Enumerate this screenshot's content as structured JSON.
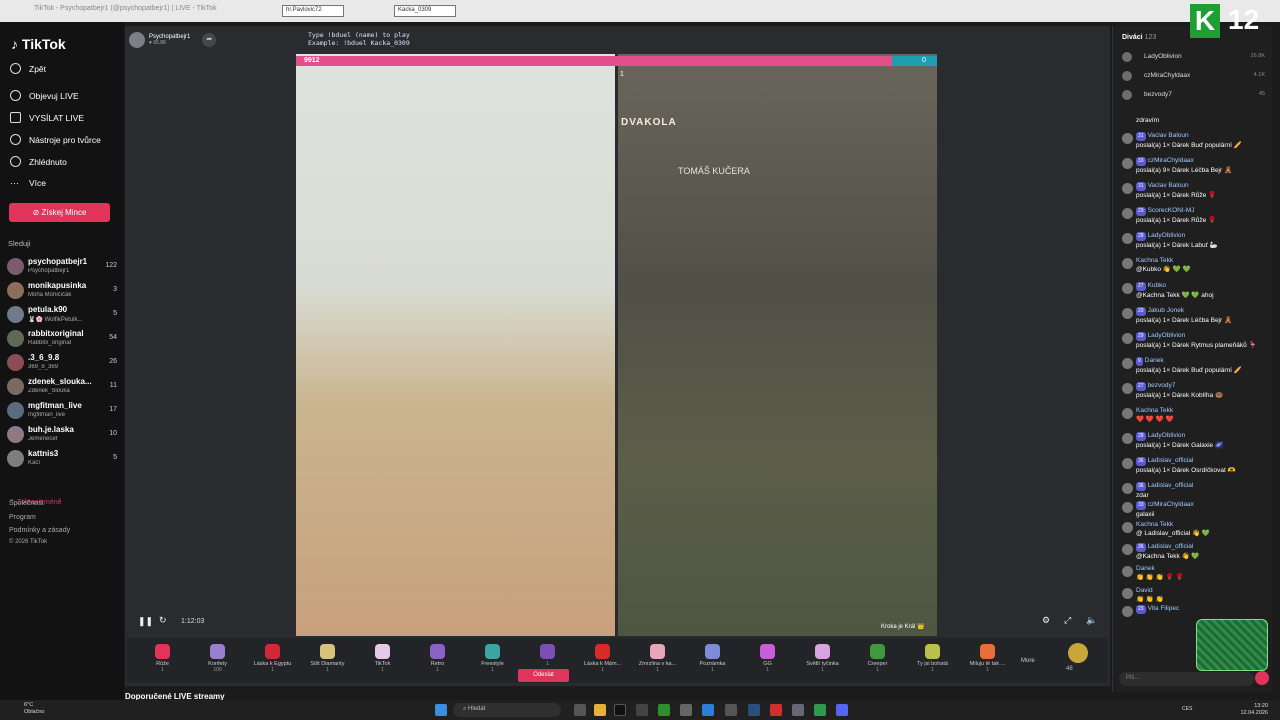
{
  "browser": {
    "url": "TikTok - Psychopatbejr1 (@psychopatbejr1) | LIVE - TikTok",
    "tabs": [
      "hr.Pavlovic72",
      "Kacka_0309"
    ]
  },
  "sidebar": {
    "brand": "TikTok",
    "nav": [
      {
        "label": "Zpět",
        "icon": "back-arrow-icon"
      },
      {
        "label": "Objevuj LIVE",
        "icon": "live-icon"
      },
      {
        "label": "VYSÍLAT LIVE",
        "icon": "broadcast-icon"
      },
      {
        "label": "Nástroje pro tvůrce",
        "icon": "tools-icon"
      },
      {
        "label": "Zhlédnuto",
        "icon": "history-icon"
      },
      {
        "label": "Více",
        "icon": "more-icon"
      }
    ],
    "coins_button": "Získej Mince",
    "following_header": "Sleduji",
    "following": [
      {
        "name": "psychopatbejr1",
        "sub": "Psychopatbejr1",
        "count": "122"
      },
      {
        "name": "monikapusinka",
        "sub": "Moňa Moničičák",
        "count": "3"
      },
      {
        "name": "petula.k90",
        "sub": "🐰🌸 WolfikPetulk...",
        "count": "5"
      },
      {
        "name": "rabbitxoriginal",
        "sub": "Rabbitx_original",
        "count": "54"
      },
      {
        "name": ".3_6_9.8",
        "sub": "369_8_369",
        "count": "26"
      },
      {
        "name": "zdenek_slouka...",
        "sub": "Zdenek_Slouka",
        "count": "11"
      },
      {
        "name": "mgfitman_live",
        "sub": "mgfitman_live",
        "count": "17"
      },
      {
        "name": "buh.je.laska",
        "sub": "Jemenecef",
        "count": "10"
      },
      {
        "name": "kattnis3",
        "sub": "Kačí",
        "count": "5"
      }
    ],
    "show_more": "Zobrazit méně",
    "footer": [
      "Společnost",
      "Program",
      "Podmínky a zásady",
      "© 2026 TikTok"
    ]
  },
  "stream": {
    "host_name": "Psychopatbejr1",
    "host_likes": "65.8K",
    "type_hint_line1": "Type !bduel (name) to play",
    "type_hint_line2": "Example: !bduel Kacka_0309",
    "score_left": "9912",
    "score_right": "0",
    "score_left_fraction": 0.93,
    "opponent_score": "1",
    "right_banner": "DVAKOLA",
    "right_sub": "TOMÁŠ KUČERA",
    "elapsed": "1:12:03",
    "opponent_label": "Kroka je Král 👑",
    "gifts": [
      {
        "name": "Růže",
        "price": "1"
      },
      {
        "name": "Konfety",
        "price": "100"
      },
      {
        "name": "Láska k Egyptu",
        "price": "1"
      },
      {
        "name": "Šišt Diamanty",
        "price": "1"
      },
      {
        "name": "TikTok",
        "price": "1"
      },
      {
        "name": "Retro",
        "price": "1"
      },
      {
        "name": "Freestyle",
        "price": "1"
      },
      {
        "name": "",
        "price": "1"
      },
      {
        "name": "Láska k Mám...",
        "price": "1"
      },
      {
        "name": "Zmrzlina v ka...",
        "price": "1"
      },
      {
        "name": "Poznámka",
        "price": "1"
      },
      {
        "name": "GG",
        "price": "1"
      },
      {
        "name": "Světlí tyčinka",
        "price": "1"
      },
      {
        "name": "Creeper",
        "price": "1"
      },
      {
        "name": "Ty jsi bohatá",
        "price": "1"
      },
      {
        "name": "Miluju tě tak ...",
        "price": "1"
      }
    ],
    "send_button": "Odeslat",
    "more_label": "More",
    "coin_balance": "46",
    "recommended_header": "Doporučené LIVE streamy"
  },
  "chat": {
    "viewers_label": "Diváci",
    "viewers_count": "123",
    "top_viewers": [
      {
        "name": "LadyOblivion",
        "count": "26.8K"
      },
      {
        "name": "czMiraChyldaax",
        "count": "4.1K"
      },
      {
        "name": "bezvody7",
        "count": "45"
      }
    ],
    "messages": [
      {
        "level": "",
        "user": "",
        "text": "zdravím"
      },
      {
        "level": "31",
        "user": "Vaclav Baloun",
        "text": "poslal(a) 1× Dárek Buď populární 🥖"
      },
      {
        "level": "33",
        "user": "czMiraChyldaax",
        "text": "poslal(a) 9× Dárek Léčba Bejr 🧸"
      },
      {
        "level": "31",
        "user": "Vaclav Baloun",
        "text": "poslal(a) 1× Dárek Růže 🌹"
      },
      {
        "level": "29",
        "user": "ScorecKONI-MJ",
        "text": "poslal(a) 1× Dárek Růže 🌹"
      },
      {
        "level": "28",
        "user": "LadyOblivion",
        "text": "poslal(a) 1× Dárek Labuť 🦢"
      },
      {
        "level": "",
        "user": "Kachna Tekk",
        "text": "@Kubko 👋 💚 💚"
      },
      {
        "level": "27",
        "user": "Kubko",
        "text": "@Kachna Tekk 💚 💚 ahoj"
      },
      {
        "level": "20",
        "user": "Jakub Jonek",
        "text": "poslal(a) 1× Dárek Léčba Bejr 🧸"
      },
      {
        "level": "29",
        "user": "LadyOblivion",
        "text": "poslal(a) 1× Dárek Rytmus plameňáků 🦩"
      },
      {
        "level": "9",
        "user": "Danek",
        "text": "poslal(a) 1× Dárek Buď populární 🥖"
      },
      {
        "level": "27",
        "user": "bezvody7",
        "text": "poslal(a) 1× Dárek Koblíha 🍩"
      },
      {
        "level": "",
        "user": "Kachna Tekk",
        "text": "❤️ ❤️ ❤️ ❤️"
      },
      {
        "level": "28",
        "user": "LadyOblivion",
        "text": "poslal(a) 1× Dárek Galaxie 🌌"
      },
      {
        "level": "36",
        "user": "Ladislav_official",
        "text": "poslal(a) 1× Dárek Osrdíčkovat 🫶"
      },
      {
        "level": "36",
        "user": "Ladislav_official",
        "text": "zdar"
      },
      {
        "level": "33",
        "user": "czMiraChyldaax",
        "text": "galaxii"
      },
      {
        "level": "",
        "user": "Kachna Tekk",
        "text": "@ Ladislav_official 👋 💚"
      },
      {
        "level": "36",
        "user": "Ladislav_official",
        "text": "@Kachna Tekk 👋 💚"
      },
      {
        "level": "",
        "user": "Danek",
        "text": "👏 👏 👏 🌹 🌹"
      },
      {
        "level": "",
        "user": "David",
        "text": "👏 👏 👏"
      },
      {
        "level": "23",
        "user": "Vita Filipec",
        "text": ""
      }
    ],
    "input_placeholder": "Piš..."
  },
  "overlay": {
    "logo_letter": "K",
    "logo_number": "12"
  },
  "taskbar": {
    "weather_temp": "6°C",
    "weather_desc": "Oblačno",
    "search_placeholder": "Hledat",
    "lang": "CES",
    "time": "13:20",
    "date": "12.04.2026"
  },
  "colors": {
    "accent": "#e0345b",
    "score_left": "#e24d8a",
    "score_right": "#1d9fb3",
    "k_logo": "#1f9f33"
  }
}
